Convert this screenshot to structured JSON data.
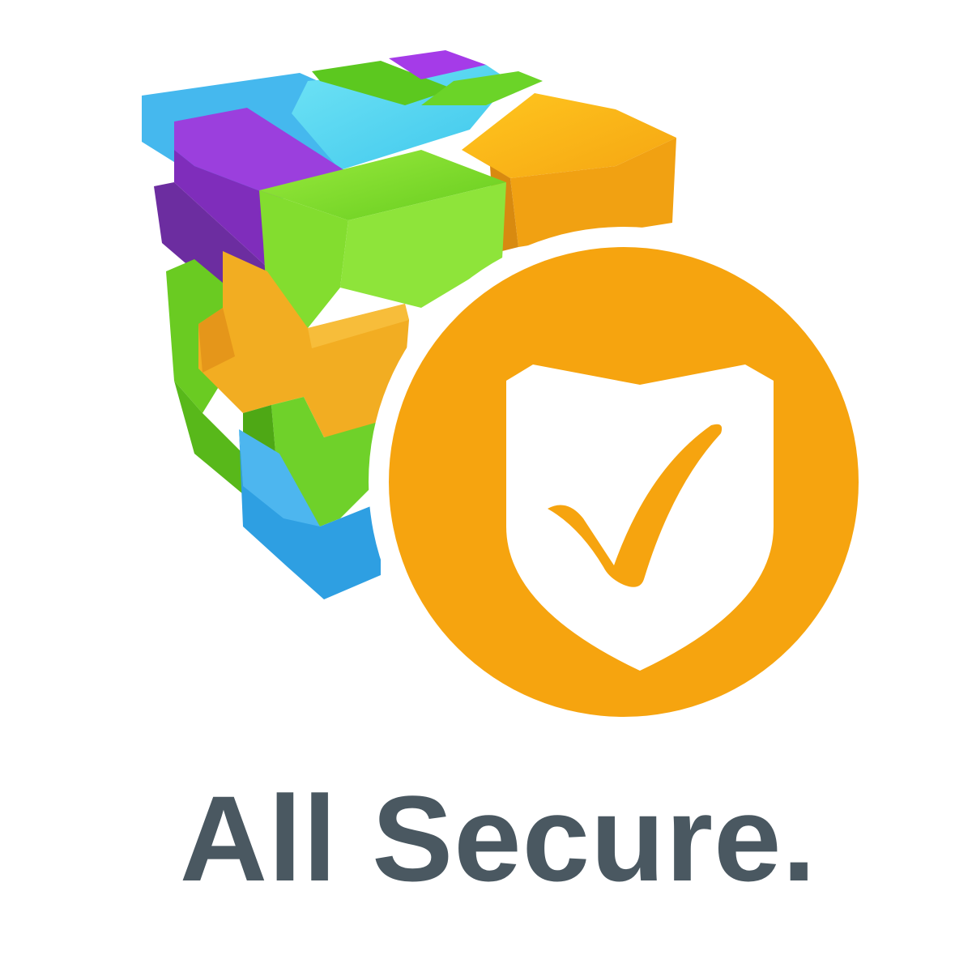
{
  "logo": {
    "cube_icon": "puzzle-cube-icon",
    "badge_icon": "shield-check-icon",
    "colors": {
      "orange": "#F6A40F",
      "purple": "#8B2FC9",
      "light_blue": "#3FB6E8",
      "blue": "#2E9BE0",
      "green": "#7DDB2A",
      "cyan": "#5ED8EF",
      "yellow_orange": "#F7B51A",
      "white": "#FFFFFF"
    }
  },
  "tagline": {
    "text": "All Secure.",
    "color": "#4A5861"
  }
}
